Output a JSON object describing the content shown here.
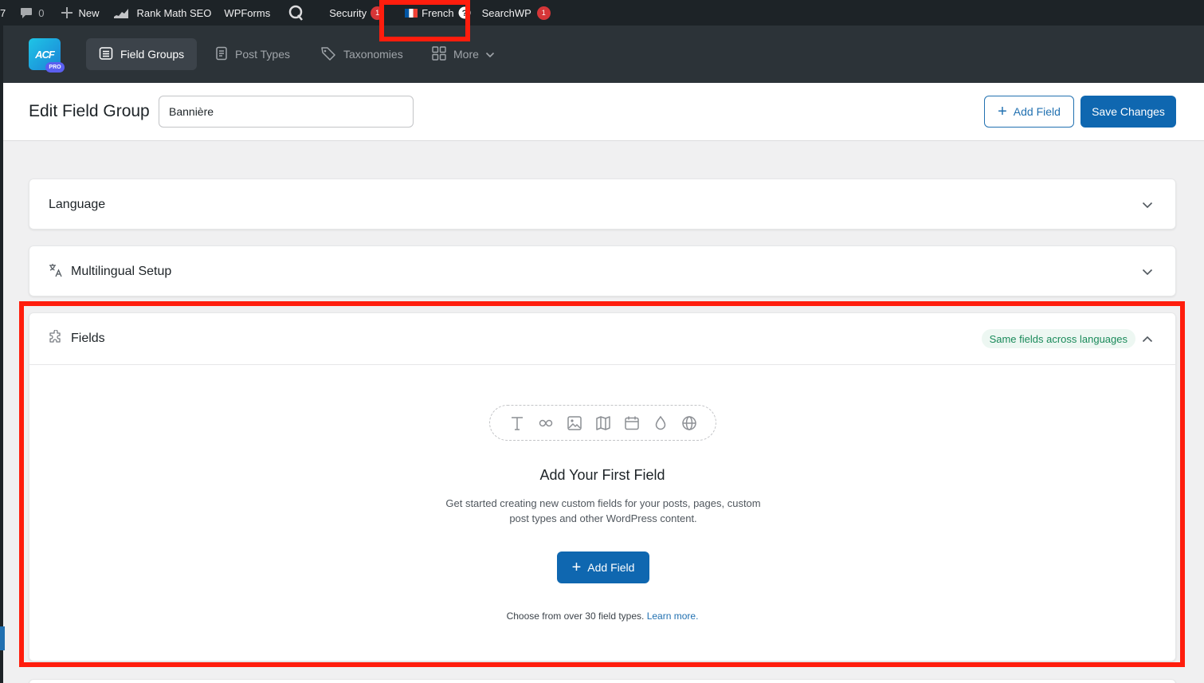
{
  "adminbar": {
    "num": "7",
    "comments": "0",
    "new": "New",
    "rankmath": "Rank Math SEO",
    "wpforms": "WPForms",
    "security": "Security",
    "security_badge": "1",
    "language": "French",
    "searchwp": "SearchWP",
    "searchwp_badge": "1"
  },
  "acf": {
    "logo": "ACF",
    "logo_pro": "PRO",
    "tabs": {
      "field_groups": "Field Groups",
      "post_types": "Post Types",
      "taxonomies": "Taxonomies",
      "more": "More"
    }
  },
  "titlebar": {
    "title": "Edit Field Group",
    "group_name": "Bannière",
    "add_field": "Add Field",
    "save": "Save Changes"
  },
  "panels": {
    "language": "Language",
    "multilingual": "Multilingual Setup",
    "fields": "Fields",
    "fields_badge": "Same fields across languages"
  },
  "empty_state": {
    "title": "Add Your First Field",
    "desc": "Get started creating new custom fields for your posts, pages, custom post types and other WordPress content.",
    "button": "Add Field",
    "foot": "Choose from over 30 field types.",
    "foot_link": "Learn more."
  },
  "colors": {
    "admin_bar": "#1d2327",
    "acf_header": "#2c3338",
    "primary": "#0f67b0",
    "annotation": "#ff1d0d"
  }
}
